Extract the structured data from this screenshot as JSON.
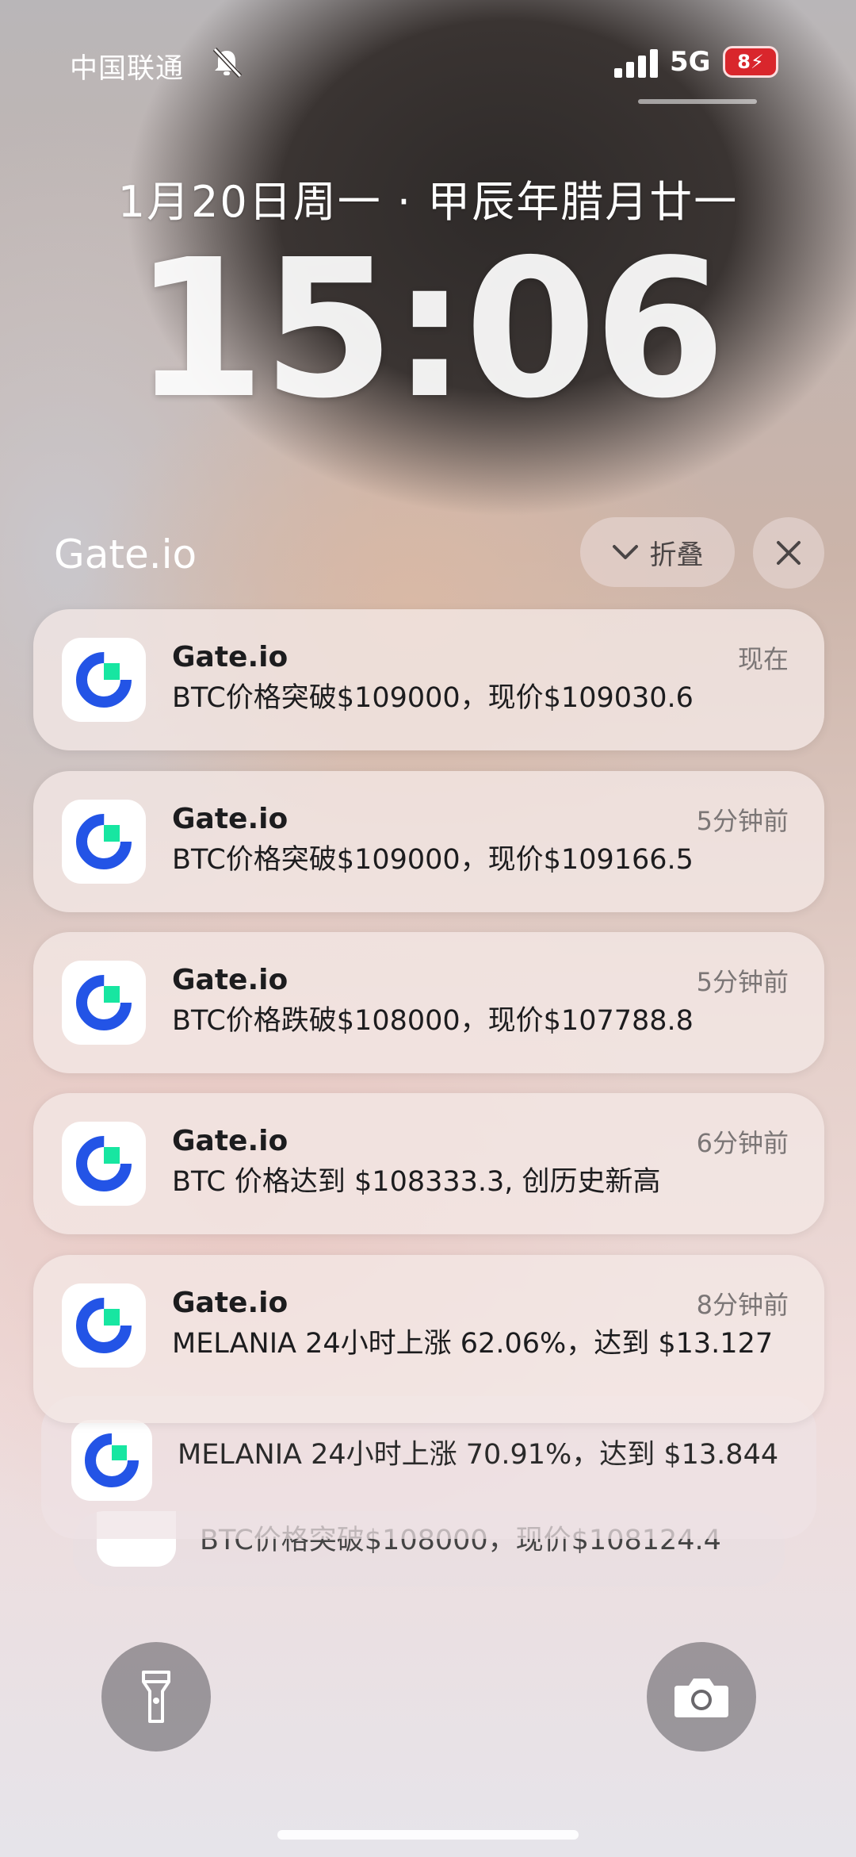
{
  "status_bar": {
    "carrier": "中国联通",
    "network": "5G",
    "battery": "8"
  },
  "lock": {
    "date": "1月20日周一 · 甲辰年腊月廿一",
    "time": "15:06"
  },
  "group": {
    "title": "Gate.io",
    "collapse_label": "折叠"
  },
  "notifications": [
    {
      "app": "Gate.io",
      "time": "现在",
      "body": "BTC价格突破$109000，现价$109030.6"
    },
    {
      "app": "Gate.io",
      "time": "5分钟前",
      "body": "BTC价格突破$109000，现价$109166.5"
    },
    {
      "app": "Gate.io",
      "time": "5分钟前",
      "body": "BTC价格跌破$108000，现价$107788.8"
    },
    {
      "app": "Gate.io",
      "time": "6分钟前",
      "body": "BTC 价格达到 $108333.3, 创历史新高"
    },
    {
      "app": "Gate.io",
      "time": "8分钟前",
      "body": "MELANIA 24小时上涨 62.06%，达到 $13.127"
    }
  ],
  "stacked": [
    {
      "body": "MELANIA 24小时上涨 70.91%，达到 $13.844"
    },
    {
      "body": "BTC价格突破$108000，现价$108124.4"
    }
  ],
  "icons": {
    "mute": "bell-slash-icon",
    "flashlight": "flashlight-icon",
    "camera": "camera-icon",
    "app": "gate-io-logo-icon"
  }
}
